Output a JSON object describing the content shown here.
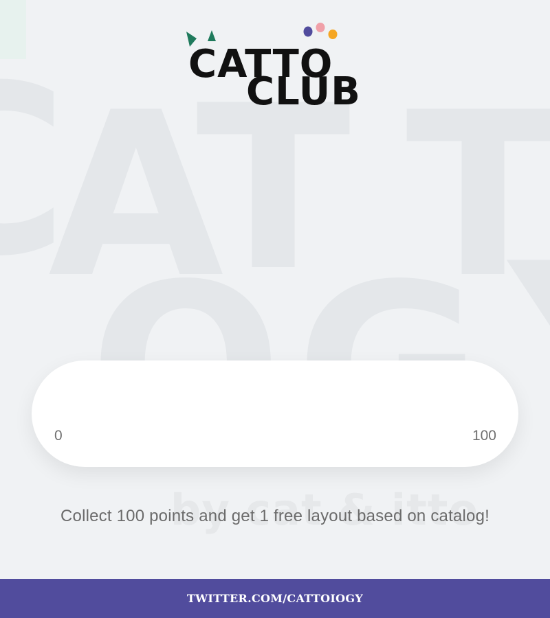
{
  "colors": {
    "background": "#f0f2f4",
    "watermark": "#e4e7ea",
    "accent": "#514c9d",
    "card": "#ffffff",
    "text_muted": "#6b6b6b",
    "logo_black": "#111111",
    "logo_green": "#1f7a5c",
    "dot_purple": "#514c9d",
    "dot_pink": "#f0a0a8",
    "dot_orange": "#f5a623"
  },
  "logo": {
    "line1": "CATTO",
    "line2": "CLUB"
  },
  "watermark": {
    "letters": [
      "C",
      "A",
      "T",
      "T",
      "O",
      "G",
      "Y"
    ],
    "byline": "by cat & itto"
  },
  "progress": {
    "value": 0,
    "min_label": "0",
    "max_label": "100"
  },
  "promo": {
    "text": "Collect 100 points and get 1 free layout based on catalog!"
  },
  "footer": {
    "link_text": "TWITTER.COM/CATTOIOGY"
  }
}
